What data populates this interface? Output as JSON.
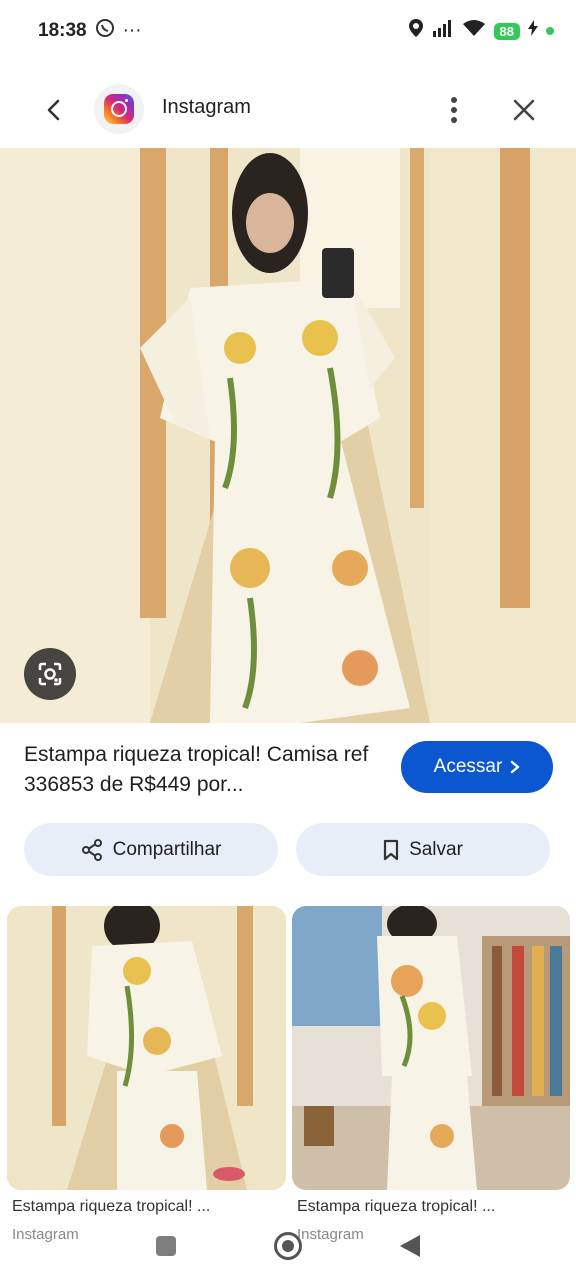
{
  "status_bar": {
    "time": "18:38",
    "whatsapp_icon": "whatsapp-icon",
    "more_notifications": "···",
    "battery": "88"
  },
  "app_bar": {
    "title": "Instagram",
    "icons": [
      "back-arrow-icon",
      "instagram-logo",
      "more-vert-icon",
      "close-icon"
    ]
  },
  "result": {
    "caption": "Estampa riqueza tropical! Camisa ref 336853 de R$449 por...",
    "visit_label": "Acessar",
    "share_label": "Compartilhar",
    "save_label": "Salvar"
  },
  "related": [
    {
      "title": "Estampa riqueza tropical! ...",
      "source": "Instagram"
    },
    {
      "title": "Estampa riqueza tropical! ...",
      "source": "Instagram"
    }
  ],
  "colors": {
    "accent": "#0b57d0",
    "chip_bg": "#e8eef8",
    "battery": "#34c759"
  }
}
